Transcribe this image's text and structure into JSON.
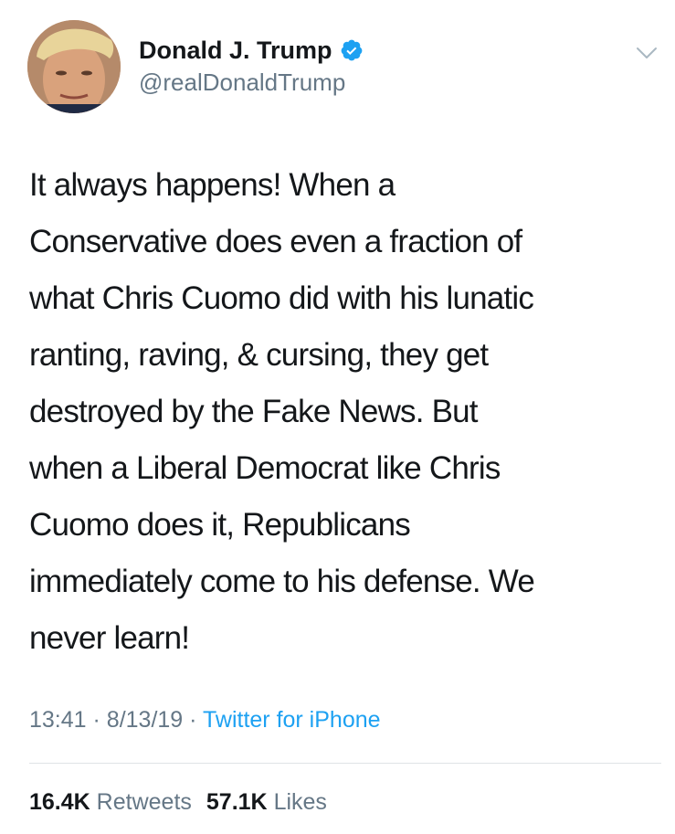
{
  "author": {
    "display_name": "Donald J. Trump",
    "handle": "@realDonaldTrump",
    "verified": true,
    "avatar_icon": "profile-photo"
  },
  "tweet": {
    "lines": [
      "It always happens! When a",
      "Conservative does even a fraction of",
      "what Chris Cuomo did with his lunatic",
      "ranting, raving, & cursing, they get",
      "destroyed by the Fake News. But",
      "when a Liberal Democrat like Chris",
      "Cuomo does it, Republicans",
      "immediately come to his defense. We",
      "never learn!"
    ]
  },
  "meta": {
    "time": "13:41",
    "separator": "·",
    "date": "8/13/19",
    "source": "Twitter for iPhone"
  },
  "stats": {
    "retweets_count": "16.4K",
    "retweets_label": "Retweets",
    "likes_count": "57.1K",
    "likes_label": "Likes"
  },
  "colors": {
    "text": "#14171a",
    "secondary": "#657786",
    "accent": "#1da1f2",
    "divider": "#dfe3e6"
  },
  "icons": {
    "verified": "verified-badge-icon",
    "menu": "chevron-down-icon"
  }
}
